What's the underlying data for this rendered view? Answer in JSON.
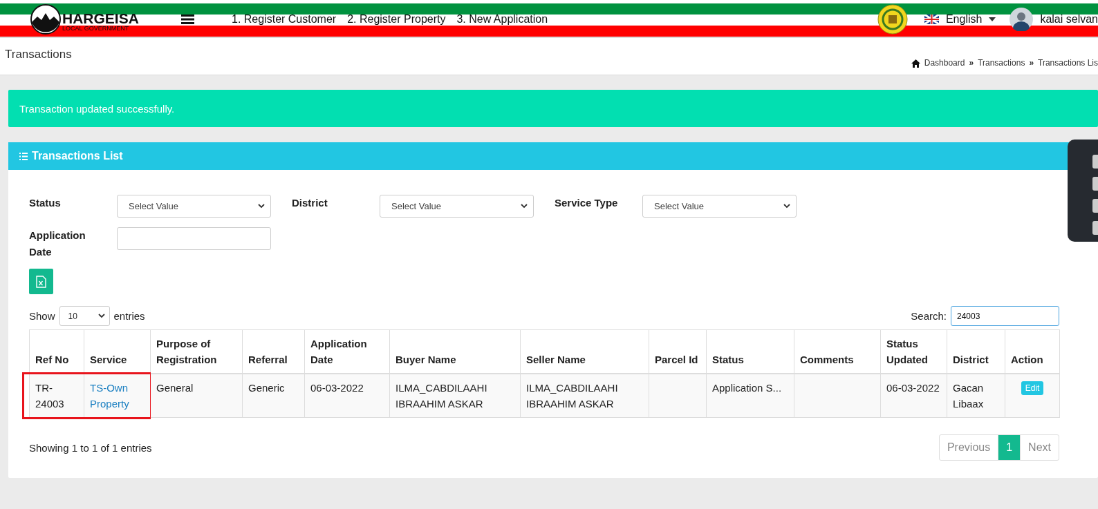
{
  "header": {
    "brand": "HARGEISA",
    "brand_sub": "LOCAL GOVERNMENT",
    "nav": [
      "1. Register Customer",
      "2. Register Property",
      "3. New Application"
    ],
    "language": "English",
    "user": "kalai selvan"
  },
  "page": {
    "title": "Transactions",
    "breadcrumb": [
      "Dashboard",
      "Transactions",
      "Transactions Lis"
    ],
    "separator": "»"
  },
  "alert": {
    "message": "Transaction updated successfully."
  },
  "card": {
    "title": "Transactions List",
    "filters": [
      {
        "label": "Status",
        "kind": "select",
        "placeholder": "Select Value"
      },
      {
        "label": "District",
        "kind": "select",
        "placeholder": "Select Value"
      },
      {
        "label": "Service Type",
        "kind": "select",
        "placeholder": "Select Value"
      },
      {
        "label": "Application Date",
        "kind": "input"
      }
    ],
    "length": {
      "before": "Show",
      "value": "10",
      "after": "entries"
    },
    "search": {
      "label": "Search:",
      "value": "24003"
    },
    "table": {
      "columns": [
        "Ref No",
        "Service",
        "Purpose of Registration",
        "Referral",
        "Application Date",
        "Buyer Name",
        "Seller Name",
        "Parcel Id",
        "Status",
        "Comments",
        "Status Updated",
        "District",
        "Action"
      ],
      "rows": [
        {
          "framed": true,
          "cells": [
            {
              "kind": "text",
              "text": "TR-24003"
            },
            {
              "kind": "link",
              "text": "TS-Own Property"
            },
            {
              "kind": "text",
              "text": "General"
            },
            {
              "kind": "text",
              "text": "Generic"
            },
            {
              "kind": "text",
              "text": "06-03-2022"
            },
            {
              "kind": "text",
              "text": "ILMA_CABDILAAHI IBRAAHIM ASKAR"
            },
            {
              "kind": "text",
              "text": "ILMA_CABDILAAHI IBRAAHIM ASKAR"
            },
            {
              "kind": "text",
              "text": ""
            },
            {
              "kind": "text",
              "text": "Application S..."
            },
            {
              "kind": "text",
              "text": ""
            },
            {
              "kind": "text",
              "text": "06-03-2022"
            },
            {
              "kind": "text",
              "text": "Gacan Libaax"
            },
            {
              "kind": "button",
              "text": "Edit"
            }
          ]
        }
      ]
    },
    "info": "Showing 1 to 1 of 1 entries",
    "pagination": [
      {
        "label": "Previous",
        "selected": false,
        "disabled": true
      },
      {
        "label": "1",
        "selected": true,
        "disabled": false
      },
      {
        "label": "Next",
        "selected": false,
        "disabled": true
      }
    ]
  }
}
